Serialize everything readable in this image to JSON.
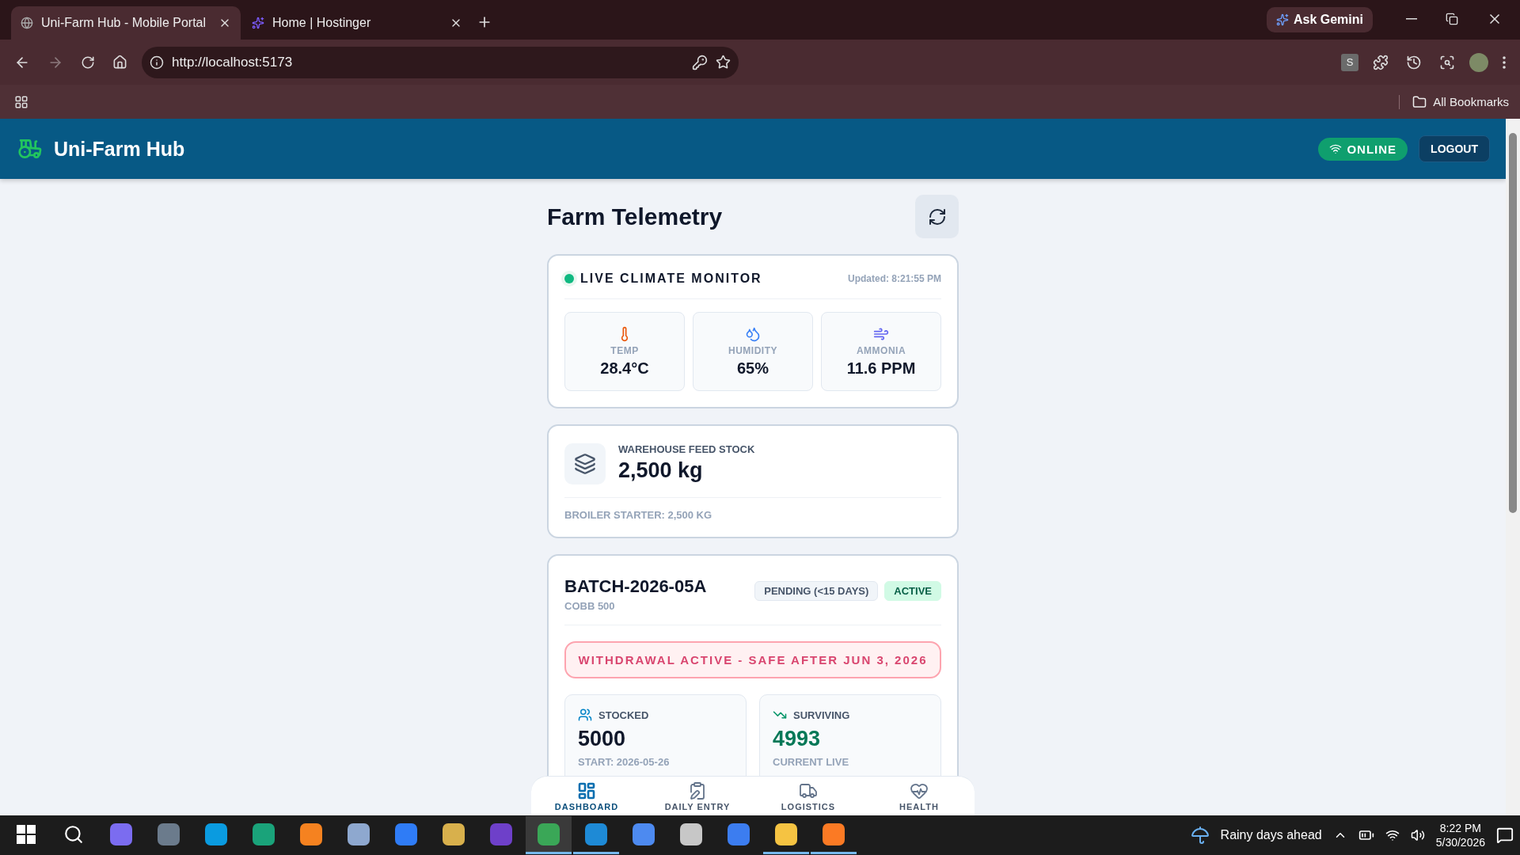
{
  "browser": {
    "tabs": [
      {
        "title": "Uni-Farm Hub - Mobile Portal",
        "kind": "globe",
        "selected": true
      },
      {
        "title": "Home | Hostinger",
        "kind": "hostinger",
        "selected": false
      }
    ],
    "gemini": "Ask Gemini",
    "url": "http://localhost:5173",
    "profile_badge": "S",
    "bookmarks": "All Bookmarks"
  },
  "header": {
    "brand": "Uni-Farm Hub",
    "status": "ONLINE",
    "logout": "LOGOUT"
  },
  "page_title": "Farm Telemetry",
  "climate": {
    "title": "LIVE CLIMATE MONITOR",
    "updated": "Updated: 8:21:55 PM",
    "metrics": [
      {
        "kind": "temp",
        "label": "TEMP",
        "value": "28.4°C"
      },
      {
        "kind": "humidity",
        "label": "HUMIDITY",
        "value": "65%"
      },
      {
        "kind": "ammonia",
        "label": "AMMONIA",
        "value": "11.6 PPM"
      }
    ]
  },
  "feed": {
    "label": "WAREHOUSE FEED STOCK",
    "value": "2,500 kg",
    "detail": "BROILER STARTER: 2,500 KG"
  },
  "batch": {
    "id": "BATCH-2026-05A",
    "breed": "COBB 500",
    "tags": [
      {
        "kind": "pending",
        "label": "PENDING (<15 DAYS)"
      },
      {
        "kind": "active",
        "label": "ACTIVE"
      }
    ],
    "alert": "WITHDRAWAL ACTIVE - SAFE AFTER JUN 3, 2026",
    "stats": [
      {
        "kind": "stocked",
        "label": "STOCKED",
        "value": "5000",
        "note": "START: 2026-05-26"
      },
      {
        "kind": "surviving",
        "label": "SURVIVING",
        "value": "4993",
        "note": "CURRENT LIVE"
      }
    ]
  },
  "nav": [
    {
      "kind": "dashboard",
      "label": "DASHBOARD",
      "selected": true
    },
    {
      "kind": "entry",
      "label": "DAILY ENTRY",
      "selected": false
    },
    {
      "kind": "logistics",
      "label": "LOGISTICS",
      "selected": false
    },
    {
      "kind": "health",
      "label": "HEALTH",
      "selected": false
    }
  ],
  "taskbar": {
    "apps": [
      {
        "kind": "copilot",
        "running": false,
        "selected": false
      },
      {
        "kind": "camera",
        "running": false,
        "selected": false
      },
      {
        "kind": "skype",
        "running": false,
        "selected": false
      },
      {
        "kind": "edge",
        "running": false,
        "selected": false
      },
      {
        "kind": "sublime",
        "running": false,
        "selected": false
      },
      {
        "kind": "r",
        "running": false,
        "selected": false
      },
      {
        "kind": "messenger",
        "running": false,
        "selected": false
      },
      {
        "kind": "git",
        "running": false,
        "selected": false
      },
      {
        "kind": "github",
        "running": false,
        "selected": false
      },
      {
        "kind": "chrome",
        "running": true,
        "selected": true
      },
      {
        "kind": "vscode",
        "running": true,
        "selected": false
      },
      {
        "kind": "store",
        "running": false,
        "selected": false
      },
      {
        "kind": "printer",
        "running": false,
        "selected": false
      },
      {
        "kind": "arc",
        "running": false,
        "selected": false
      },
      {
        "kind": "explorer",
        "running": true,
        "selected": false
      },
      {
        "kind": "xampp",
        "running": true,
        "selected": false
      }
    ],
    "weather": "Rainy days ahead",
    "time": "8:22 PM",
    "date": "5/30/2026"
  }
}
